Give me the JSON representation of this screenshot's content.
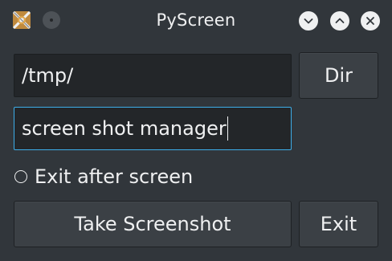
{
  "window": {
    "title": "PyScreen",
    "icons": [
      "app-icon",
      "pin-icon",
      "minimize-icon",
      "maximize-icon",
      "close-icon"
    ]
  },
  "directory": {
    "value": "/tmp/",
    "button_label": "Dir"
  },
  "filename": {
    "value": "screen shot manager"
  },
  "options": {
    "exit_after_label": "Exit after screen",
    "exit_after_checked": false
  },
  "actions": {
    "take_label": "Take Screenshot",
    "exit_label": "Exit"
  },
  "colors": {
    "background": "#31363b",
    "field_background": "#232629",
    "focus_border": "#3daee9",
    "text": "#eff0f1"
  }
}
